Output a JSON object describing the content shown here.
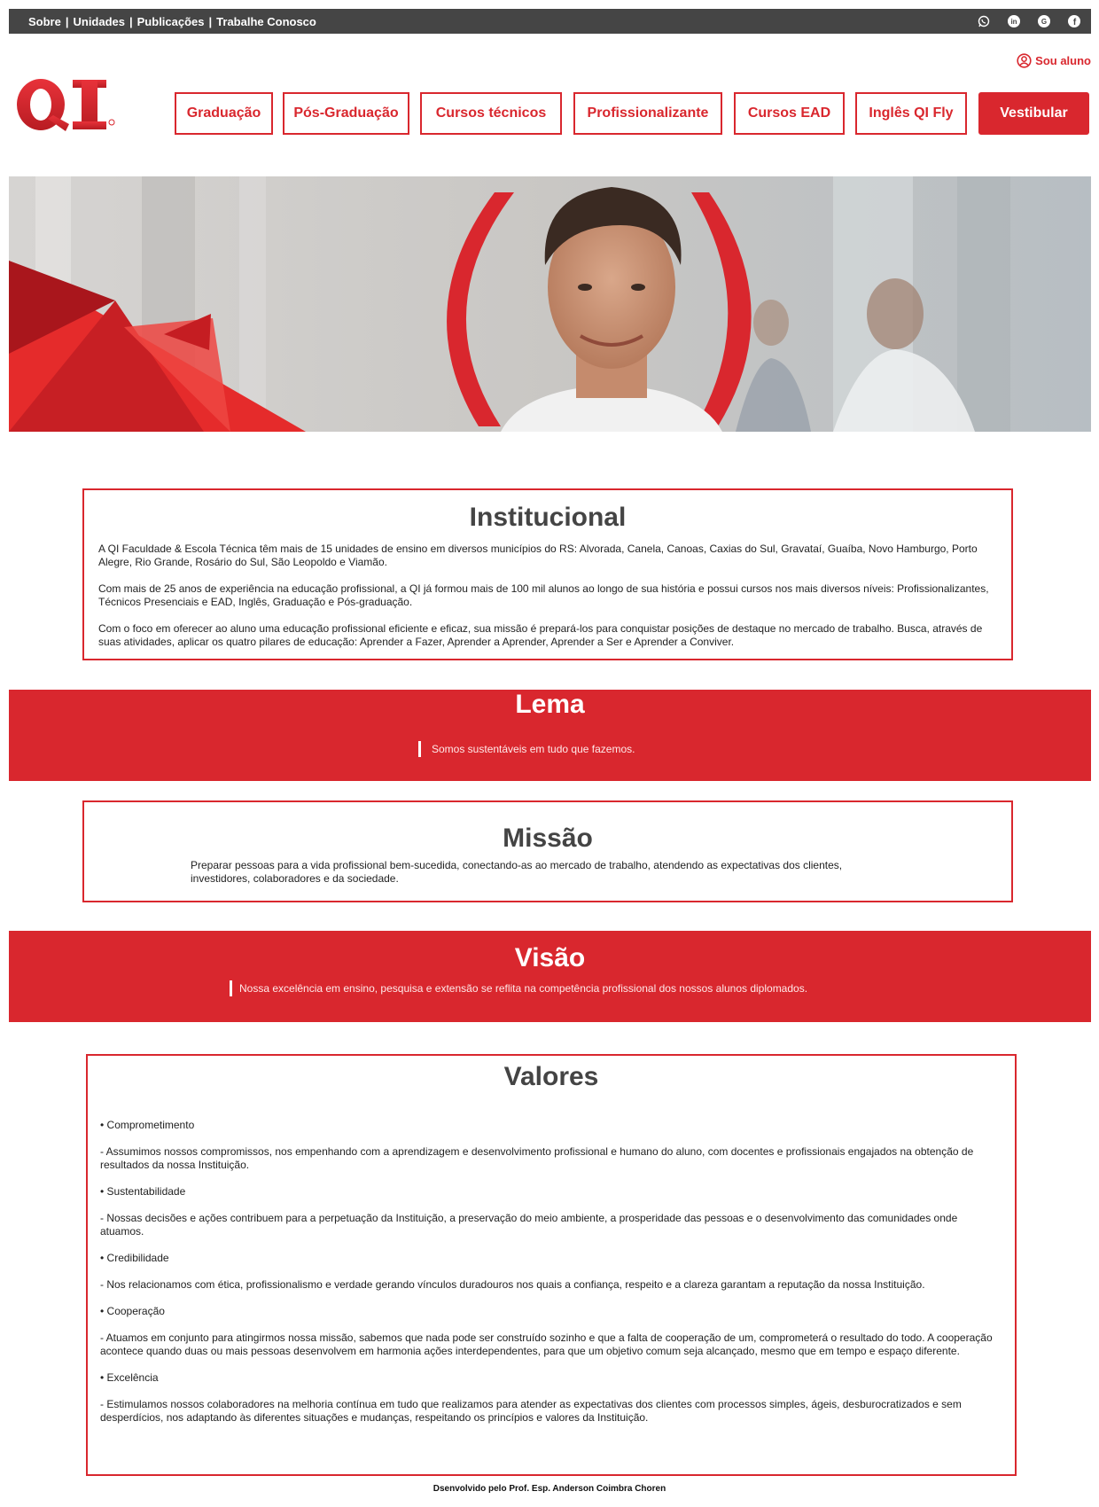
{
  "topbar": {
    "links": [
      "Sobre",
      "Unidades",
      "Publicações",
      "Trabalhe Conosco"
    ],
    "separator": "|",
    "social_icons": [
      "whatsapp-icon",
      "linkedin-icon",
      "google-icon",
      "facebook-icon"
    ]
  },
  "header": {
    "logo_text": "QI",
    "sou_aluno": "Sou aluno",
    "nav": [
      "Graduação",
      "Pós-Graduação",
      "Cursos técnicos",
      "Profissionalizante",
      "Cursos EAD",
      "Inglês QI Fly",
      "Vestibular"
    ]
  },
  "colors": {
    "brand_red": "#d9272e",
    "topbar_bg": "#454545",
    "heading_gray": "#444444"
  },
  "institucional": {
    "title": "Institucional",
    "p1": "A QI Faculdade & Escola Técnica têm mais de 15 unidades de ensino em diversos municípios do RS: Alvorada, Canela, Canoas, Caxias do Sul, Gravataí, Guaíba, Novo Hamburgo, Porto Alegre, Rio Grande, Rosário do Sul, São Leopoldo e Viamão.",
    "p2": "Com mais de 25 anos de experiência na educação profissional, a QI já formou mais de 100 mil alunos ao longo de sua história e possui cursos nos mais diversos níveis: Profissionalizantes, Técnicos Presenciais e EAD, Inglês, Graduação e Pós-graduação.",
    "p3": "Com o foco em oferecer ao aluno uma educação profissional eficiente e eficaz, sua missão é prepará-los para conquistar posições de destaque no mercado de trabalho. Busca, através de suas atividades, aplicar os quatro pilares de educação: Aprender a Fazer, Aprender a Aprender, Aprender a Ser e Aprender a Conviver."
  },
  "lema": {
    "title": "Lema",
    "text": "Somos sustentáveis em tudo que fazemos."
  },
  "missao": {
    "title": "Missão",
    "text": "Preparar pessoas para a vida profissional bem-sucedida, conectando-as ao mercado de trabalho, atendendo as expectativas dos clientes, investidores, colaboradores e da sociedade."
  },
  "visao": {
    "title": "Visão",
    "text": "Nossa excelência em ensino, pesquisa e extensão se reflita na competência profissional dos nossos alunos diplomados."
  },
  "valores": {
    "title": "Valores",
    "items": [
      "• Comprometimento",
      "- Assumimos nossos compromissos, nos empenhando com a aprendizagem e desenvolvimento profissional e humano do aluno, com docentes e profissionais engajados na obtenção de resultados da nossa Instituição.",
      "• Sustentabilidade",
      "- Nossas decisões e ações contribuem para a perpetuação da Instituição, a preservação do meio ambiente, a prosperidade das pessoas e o desenvolvimento das comunidades onde atuamos.",
      "• Credibilidade",
      "- Nos relacionamos com ética, profissionalismo e verdade gerando vínculos duradouros nos quais a confiança, respeito e a clareza garantam a reputação da nossa Instituição.",
      "• Cooperação",
      "- Atuamos em conjunto para atingirmos nossa missão, sabemos que nada pode ser construído sozinho e que a falta de cooperação de um, comprometerá o resultado do todo. A cooperação acontece quando duas ou mais pessoas desenvolvem em harmonia ações interdependentes, para que um objetivo comum seja alcançado, mesmo que em tempo e espaço diferente.",
      "• Excelência",
      "- Estimulamos nossos colaboradores na melhoria contínua em tudo que realizamos para atender as expectativas dos clientes com processos simples, ágeis, desburocratizados e sem desperdícios, nos adaptando às diferentes situações e mudanças, respeitando os princípios e valores da Instituição."
    ]
  },
  "footer": {
    "text": "Dsenvolvido pelo Prof. Esp. Anderson Coimbra Choren"
  }
}
